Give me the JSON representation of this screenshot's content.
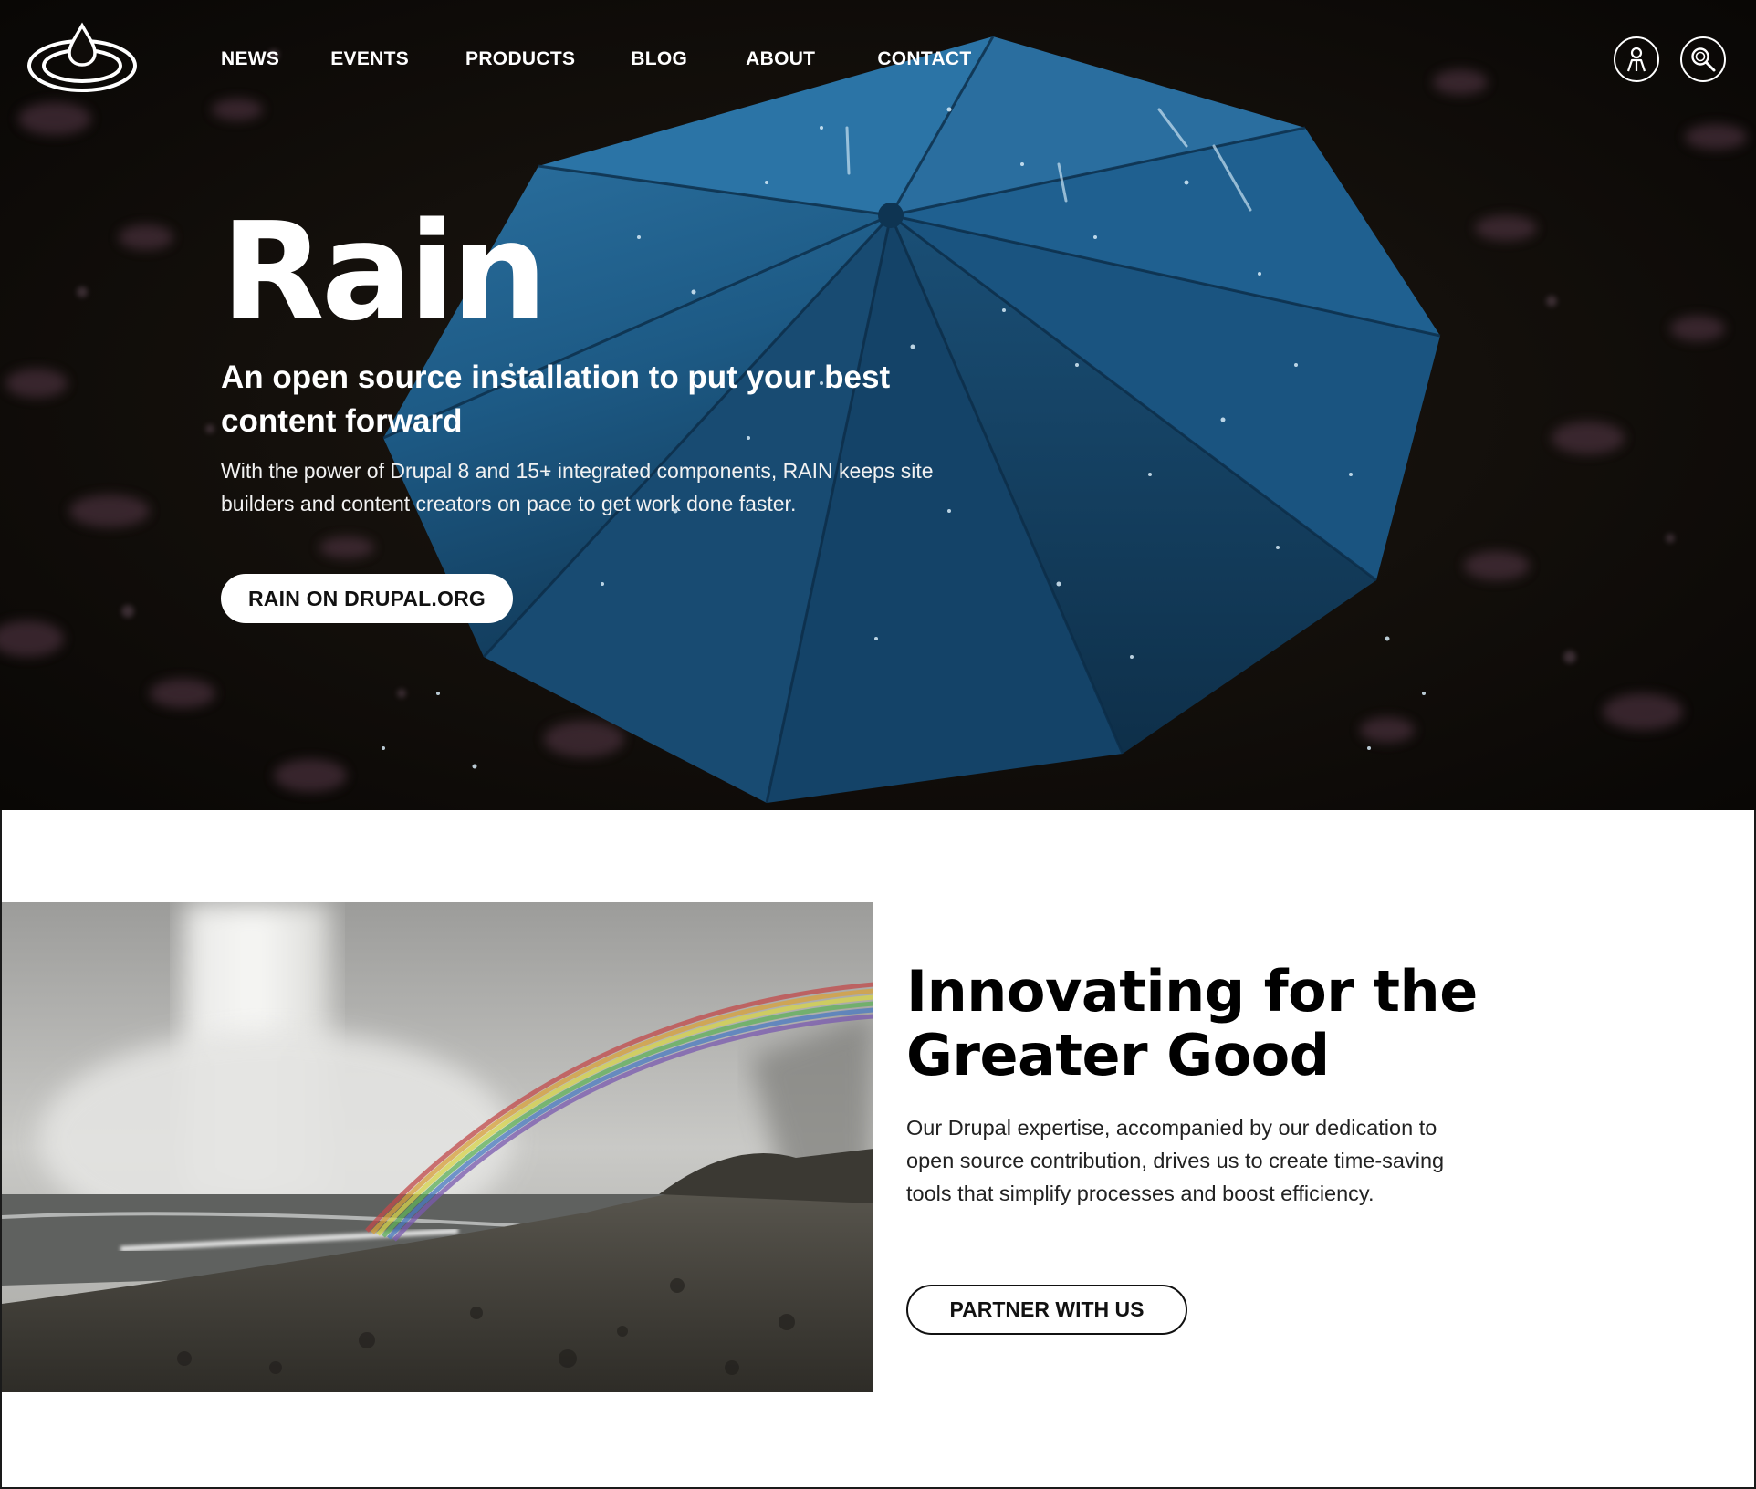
{
  "nav": {
    "items": [
      {
        "label": "NEWS"
      },
      {
        "label": "EVENTS"
      },
      {
        "label": "PRODUCTS"
      },
      {
        "label": "BLOG"
      },
      {
        "label": "ABOUT"
      },
      {
        "label": "CONTACT"
      }
    ],
    "icons": [
      "user-icon",
      "search-icon"
    ]
  },
  "hero": {
    "title": "Rain",
    "subtitle": "An open source installation to put your best content forward",
    "description": "With the power of Drupal 8 and 15+ integrated components, RAIN keeps site builders and content creators on pace to get work done faster.",
    "cta": "RAIN ON DRUPAL.ORG"
  },
  "feature": {
    "title": "Innovating for the Greater Good",
    "description": "Our Drupal expertise, accompanied by our dedication to open source contribution, drives us to create time-saving tools that simplify processes and boost efficiency.",
    "cta": "PARTNER WITH US"
  },
  "colors": {
    "hero_bg": "#0f0c09",
    "umbrella": "#1d5a85",
    "white": "#ffffff",
    "text_dark": "#111111"
  }
}
